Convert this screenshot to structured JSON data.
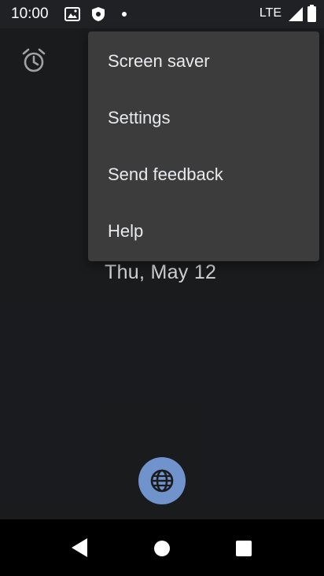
{
  "status_bar": {
    "time": "10:00",
    "network": "LTE"
  },
  "menu": {
    "items": [
      {
        "label": "Screen saver"
      },
      {
        "label": "Settings"
      },
      {
        "label": "Send feedback"
      },
      {
        "label": "Help"
      }
    ]
  },
  "main": {
    "date": "Thu, May 12"
  },
  "icons": {
    "alarm": "alarm-clock-icon",
    "fab": "globe-icon",
    "back": "back-triangle-icon",
    "home": "home-circle-icon",
    "recents": "recents-square-icon"
  },
  "colors": {
    "background": "#202124",
    "menu": "#3c3c3c",
    "fab": "#8ab4f8"
  }
}
